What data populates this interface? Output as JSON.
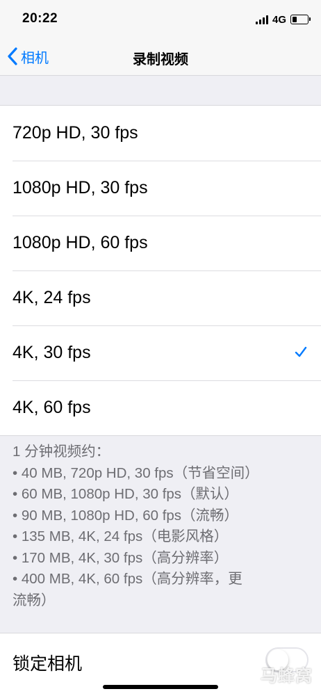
{
  "status_bar": {
    "time": "20:22",
    "network": "4G",
    "icons": [
      "signal-icon",
      "battery-icon"
    ]
  },
  "nav": {
    "back_label": "相机",
    "back_icon": "chevron-left-icon",
    "title": "录制视频",
    "accent_color": "#007aff"
  },
  "options": [
    {
      "label": "720p HD, 30 fps",
      "selected": false
    },
    {
      "label": "1080p HD, 30 fps",
      "selected": false
    },
    {
      "label": "1080p HD, 60 fps",
      "selected": false
    },
    {
      "label": "4K, 24 fps",
      "selected": false
    },
    {
      "label": "4K, 30 fps",
      "selected": true
    },
    {
      "label": "4K, 60 fps",
      "selected": false
    }
  ],
  "footer_note": {
    "lines": [
      "1 分钟视频约：",
      "• 40 MB, 720p HD, 30 fps（节省空间）",
      "• 60 MB, 1080p HD, 30 fps（默认）",
      "• 90 MB, 1080p HD, 60 fps（流畅）",
      "• 135 MB, 4K, 24 fps（电影风格）",
      "• 170 MB, 4K, 30 fps（高分辨率）",
      "• 400 MB, 4K, 60 fps（高分辨率，更",
      "流畅）"
    ]
  },
  "lock_camera": {
    "label": "锁定相机",
    "enabled": false
  },
  "watermark": {
    "text": "马蜂窝",
    "icon": "mail-logo-icon"
  }
}
